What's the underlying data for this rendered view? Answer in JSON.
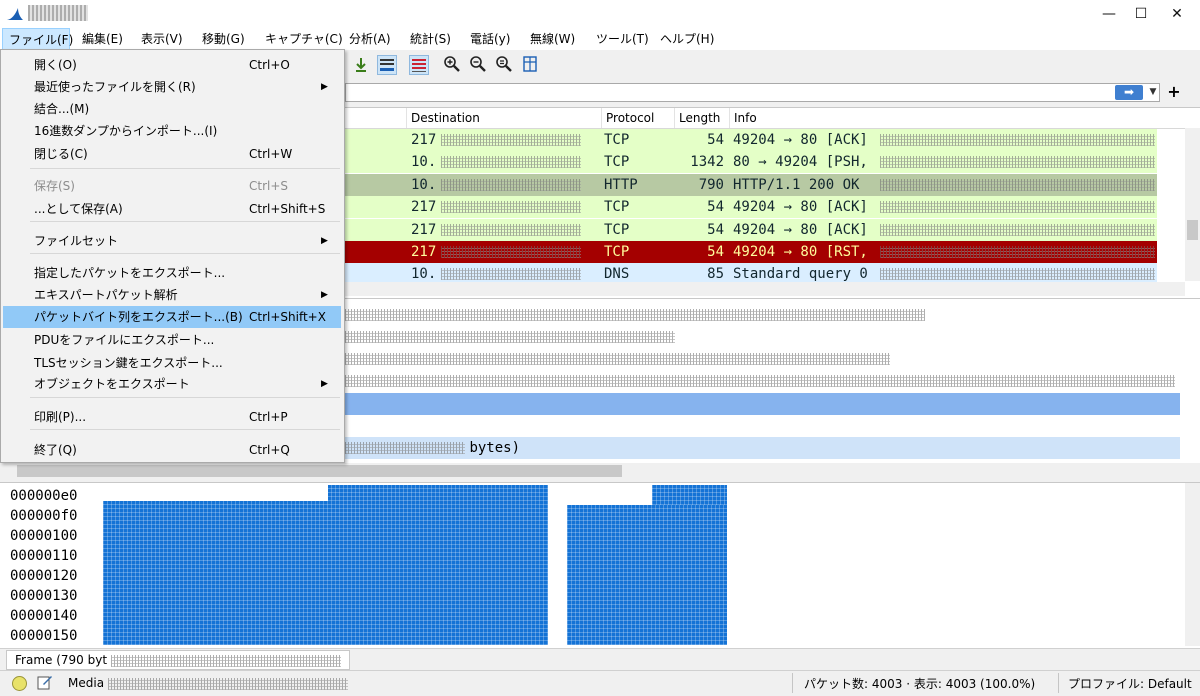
{
  "window": {
    "minimize": "—",
    "maximize": "☐",
    "close": "✕"
  },
  "menubar": [
    {
      "label": "ファイル(F)"
    },
    {
      "label": "編集(E)"
    },
    {
      "label": "表示(V)"
    },
    {
      "label": "移動(G)"
    },
    {
      "label": "キャプチャ(C)"
    },
    {
      "label": "分析(A)"
    },
    {
      "label": "統計(S)"
    },
    {
      "label": "電話(y)"
    },
    {
      "label": "無線(W)"
    },
    {
      "label": "ツール(T)"
    },
    {
      "label": "ヘルプ(H)"
    }
  ],
  "file_menu": {
    "items": [
      {
        "label": "開く(O)",
        "shortcut": "Ctrl+O"
      },
      {
        "label": "最近使ったファイルを開く(R)",
        "submenu": "▶"
      },
      {
        "label": "結合...(M)"
      },
      {
        "label": "16進数ダンプからインポート...(I)"
      },
      {
        "label": "閉じる(C)",
        "shortcut": "Ctrl+W"
      },
      {
        "label": "保存(S)",
        "shortcut": "Ctrl+S"
      },
      {
        "label": "...として保存(A)",
        "shortcut": "Ctrl+Shift+S"
      },
      {
        "label": "ファイルセット",
        "submenu": "▶"
      },
      {
        "label": "指定したパケットをエクスポート..."
      },
      {
        "label": "エキスパートパケット解析",
        "submenu": "▶"
      },
      {
        "label": "パケットバイト列をエクスポート...(B)",
        "shortcut": "Ctrl+Shift+X"
      },
      {
        "label": "PDUをファイルにエクスポート..."
      },
      {
        "label": "TLSセッション鍵をエクスポート..."
      },
      {
        "label": "オブジェクトをエクスポート",
        "submenu": "▶"
      },
      {
        "label": "印刷(P)...",
        "shortcut": "Ctrl+P"
      },
      {
        "label": "終了(Q)",
        "shortcut": "Ctrl+Q"
      }
    ]
  },
  "toolbar": {
    "icons": [
      "download-icon",
      "autoscroll-icon",
      "colorize-icon",
      "zoom-in-icon",
      "zoom-out-icon",
      "zoom-reset-icon",
      "resize-columns-icon"
    ]
  },
  "filter": {
    "apply_glyph": "➡",
    "dropdown_glyph": "▼",
    "add_glyph": "+"
  },
  "packet_list": {
    "columns": [
      "Destination",
      "Protocol",
      "Length",
      "Info"
    ],
    "rows": [
      {
        "dest": "217",
        "proto": "TCP",
        "len": "54",
        "info": "49204 → 80 [ACK]",
        "bg": "#e4ffc7",
        "fg": "#12272e"
      },
      {
        "dest": "10.",
        "proto": "TCP",
        "len": "1342",
        "info": "80 → 49204 [PSH,",
        "bg": "#e4ffc7",
        "fg": "#12272e"
      },
      {
        "dest": "10.",
        "proto": "HTTP",
        "len": "790",
        "info": "HTTP/1.1 200 OK",
        "bg": "#b7c9a3",
        "fg": "#12272e"
      },
      {
        "dest": "217",
        "proto": "TCP",
        "len": "54",
        "info": "49204 → 80 [ACK]",
        "bg": "#e4ffc7",
        "fg": "#12272e"
      },
      {
        "dest": "217",
        "proto": "TCP",
        "len": "54",
        "info": "49204 → 80 [ACK]",
        "bg": "#e4ffc7",
        "fg": "#12272e"
      },
      {
        "dest": "217",
        "proto": "TCP",
        "len": "54",
        "info": "49204 → 80 [RST,",
        "bg": "#a40000",
        "fg": "#fffc9c"
      },
      {
        "dest": "10.",
        "proto": "DNS",
        "len": "85",
        "info": "Standard query 0",
        "bg": "#daeeff",
        "fg": "#12272e"
      }
    ]
  },
  "details": {
    "bytes_suffix": "bytes)"
  },
  "hex": {
    "offsets": [
      "000000e0",
      "000000f0",
      "00000100",
      "00000110",
      "00000120",
      "00000130",
      "00000140",
      "00000150"
    ]
  },
  "frame_bar": {
    "text": "Frame (790 byt"
  },
  "statusbar": {
    "media_prefix": "Media",
    "packets": "パケット数: 4003 · 表示: 4003 (100.0%)",
    "profile": "プロファイル: Default"
  }
}
